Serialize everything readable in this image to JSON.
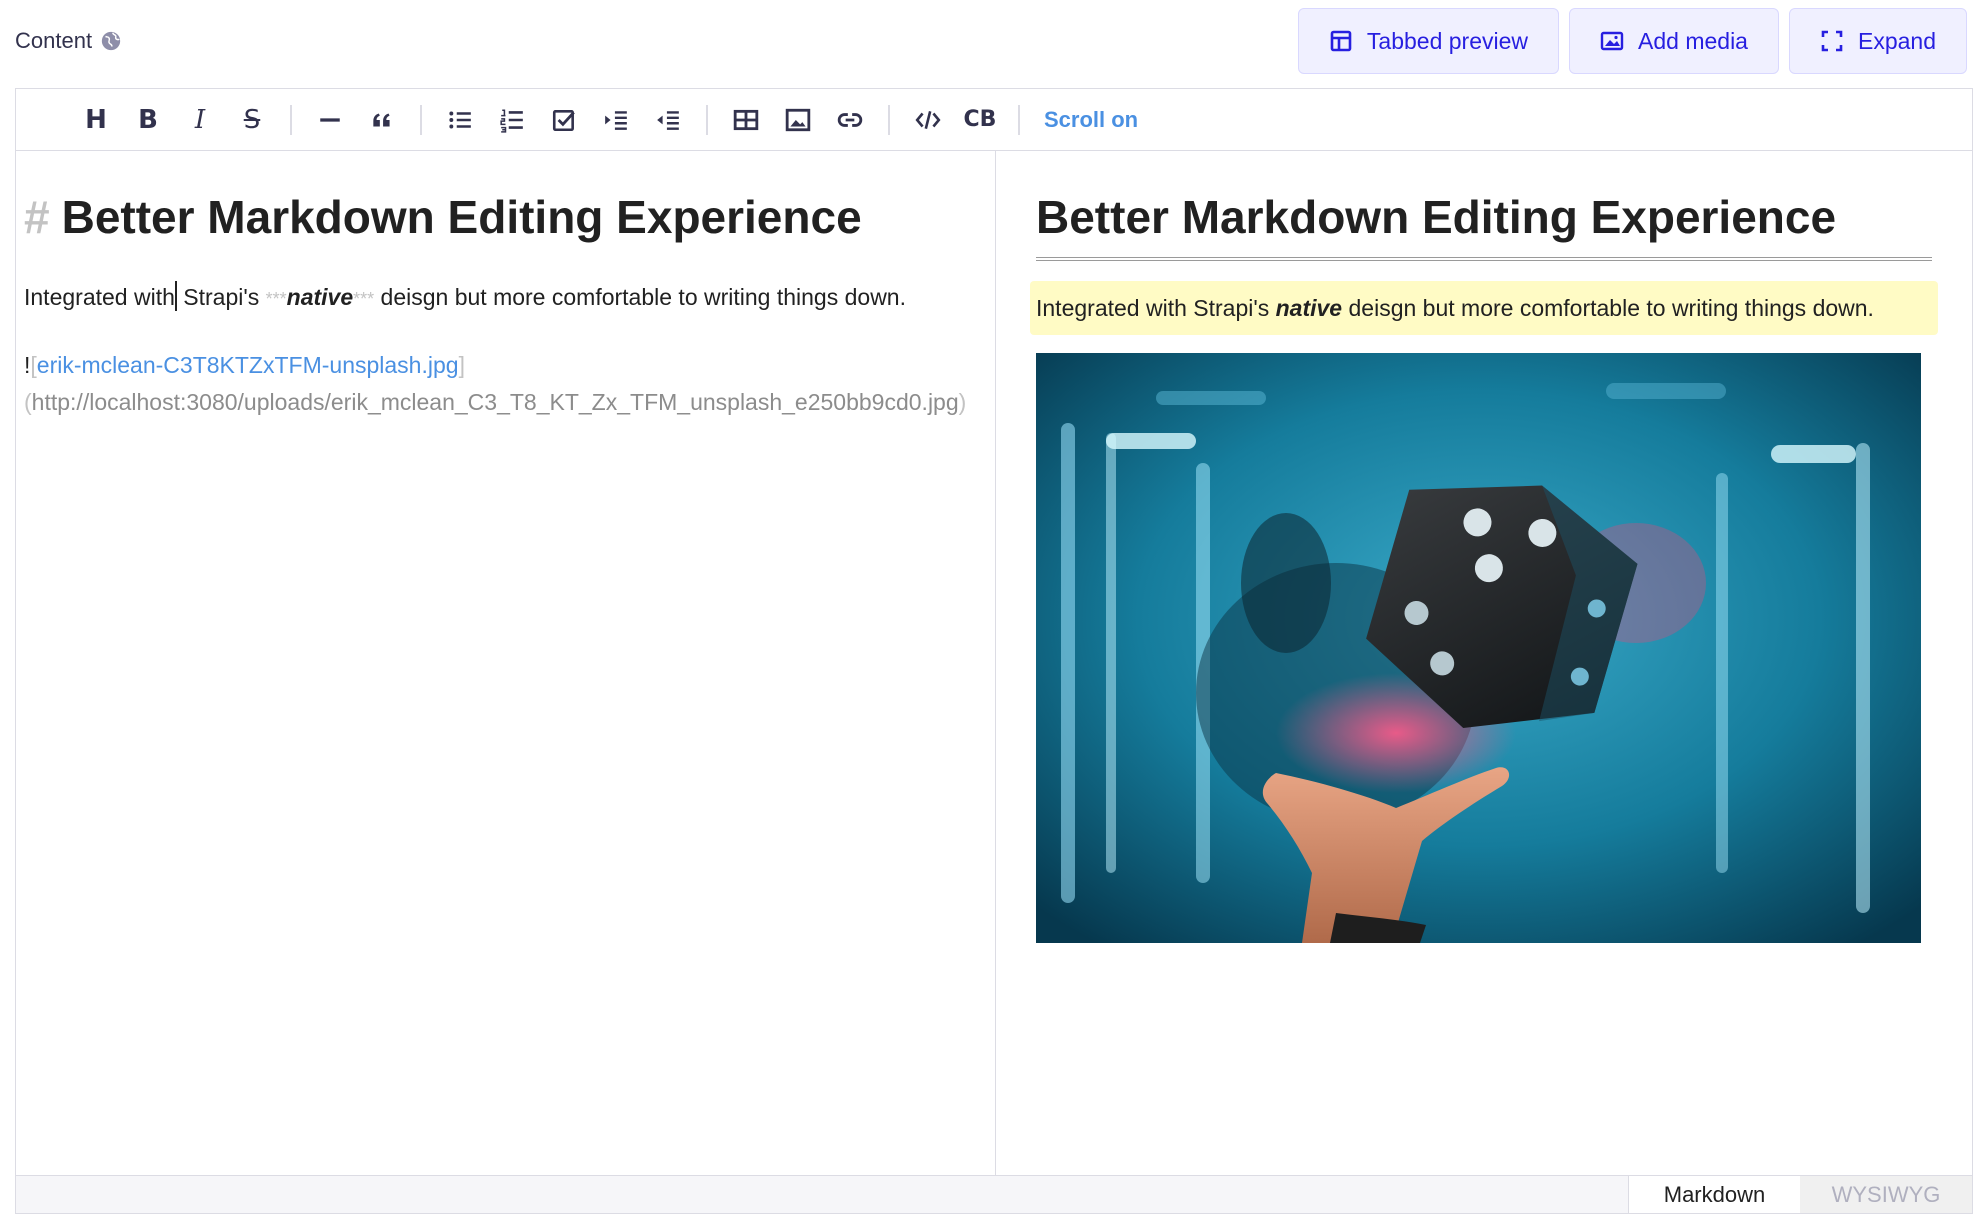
{
  "header": {
    "field_label": "Content",
    "buttons": {
      "tabbed_preview": "Tabbed preview",
      "add_media": "Add media",
      "expand": "Expand"
    }
  },
  "toolbar": {
    "items": [
      {
        "name": "heading",
        "glyph": "H"
      },
      {
        "name": "bold",
        "glyph": "B"
      },
      {
        "name": "italic",
        "glyph": "I"
      },
      {
        "name": "strikethrough",
        "glyph": "S"
      },
      {
        "name": "horizontal-rule"
      },
      {
        "name": "quote"
      },
      {
        "name": "bullet-list"
      },
      {
        "name": "numbered-list"
      },
      {
        "name": "task-list"
      },
      {
        "name": "indent"
      },
      {
        "name": "outdent"
      },
      {
        "name": "table"
      },
      {
        "name": "image"
      },
      {
        "name": "link"
      },
      {
        "name": "code"
      },
      {
        "name": "code-block",
        "glyph": "CB"
      }
    ],
    "scroll_toggle": "Scroll on"
  },
  "markdown": {
    "heading_mark": "#",
    "heading": "Better Markdown Editing Experience",
    "para_before_cursor": "Integrated with",
    "para_after_cursor": " Strapi's ",
    "em_mark_open": "***",
    "em_text": "native",
    "em_mark_close": "***",
    "para_end": " deisgn but more comfortable to writing things down.",
    "image_bang": "!",
    "image_bracket_open": "[",
    "image_alt": "erik-mclean-C3T8KTZxTFM-unsplash.jpg",
    "image_bracket_close": "]",
    "image_url_open": "(",
    "image_url": "http://localhost:3080/uploads/erik_mclean_C3_T8_KT_Zx_TFM_unsplash_e250bb9cd0.jpg",
    "image_url_close": ")"
  },
  "preview": {
    "heading": "Better Markdown Editing Experience",
    "para_start": "Integrated with Strapi's ",
    "em_text": "native",
    "para_end": " deisgn but more comfortable to writing things down."
  },
  "footer": {
    "mode_markdown": "Markdown",
    "mode_wysiwyg": "WYSIWYG",
    "active_mode": "Markdown"
  },
  "colors": {
    "accent_button_bg": "#f0f0ff",
    "accent_button_text": "#271fe0",
    "link_blue": "#4a90e2",
    "highlight_yellow": "#fffbc5",
    "border": "#dcdce4"
  }
}
